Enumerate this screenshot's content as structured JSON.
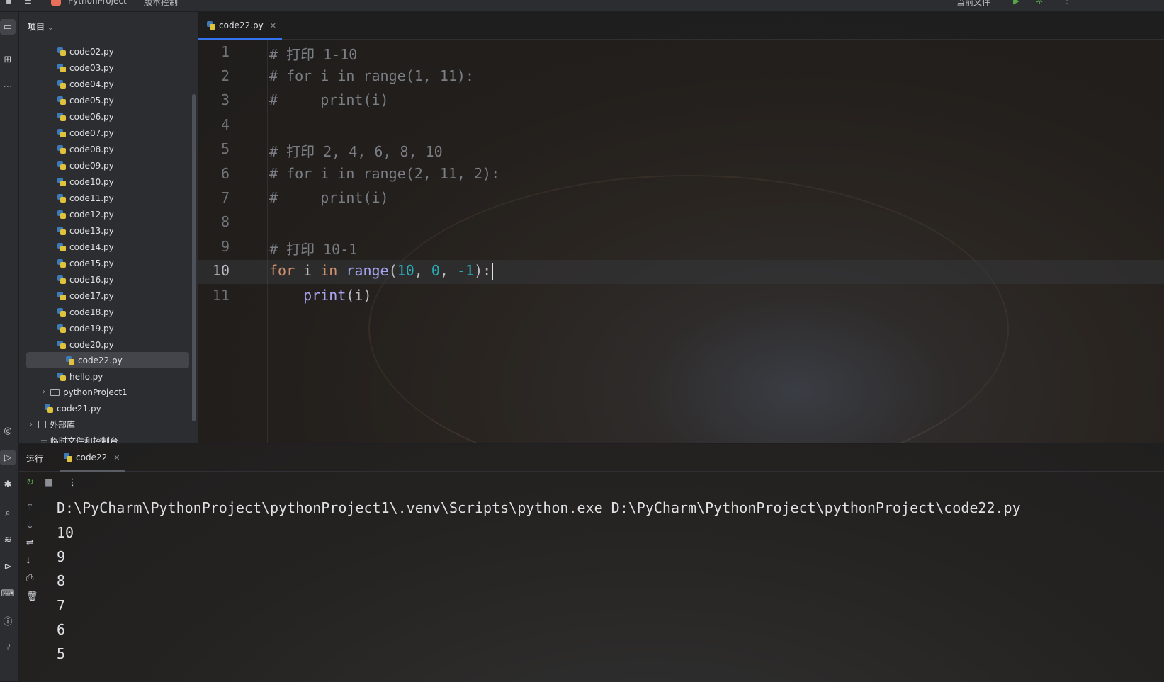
{
  "titlebar": {
    "project_name": "PythonProject",
    "vcs_label": "版本控制",
    "run_config": "当前文件"
  },
  "project_panel": {
    "header": "项目",
    "files": [
      {
        "name": "code02.py"
      },
      {
        "name": "code03.py"
      },
      {
        "name": "code04.py"
      },
      {
        "name": "code05.py"
      },
      {
        "name": "code06.py"
      },
      {
        "name": "code07.py"
      },
      {
        "name": "code08.py"
      },
      {
        "name": "code09.py"
      },
      {
        "name": "code10.py"
      },
      {
        "name": "code11.py"
      },
      {
        "name": "code12.py"
      },
      {
        "name": "code13.py"
      },
      {
        "name": "code14.py"
      },
      {
        "name": "code15.py"
      },
      {
        "name": "code16.py"
      },
      {
        "name": "code17.py"
      },
      {
        "name": "code18.py"
      },
      {
        "name": "code19.py"
      },
      {
        "name": "code20.py"
      },
      {
        "name": "code22.py",
        "selected": true
      },
      {
        "name": "hello.py"
      }
    ],
    "folder": "pythonProject1",
    "root_file": "code21.py",
    "external_libs": "外部库",
    "scratches": "临时文件和控制台"
  },
  "editor": {
    "tab": "code22.py",
    "current_line": "10",
    "lines": [
      {
        "n": "1",
        "text": "# 打印 1-10"
      },
      {
        "n": "2",
        "text": "# for i in range(1, 11):"
      },
      {
        "n": "3",
        "text": "#     print(i)"
      },
      {
        "n": "4",
        "text": ""
      },
      {
        "n": "5",
        "text": "# 打印 2, 4, 6, 8, 10"
      },
      {
        "n": "6",
        "text": "# for i in range(2, 11, 2):"
      },
      {
        "n": "7",
        "text": "#     print(i)"
      },
      {
        "n": "8",
        "text": ""
      },
      {
        "n": "9",
        "text": "# 打印 10-1"
      },
      {
        "n": "10",
        "code": {
          "kw1": "for",
          "var": " i ",
          "kw2": "in",
          "fn": "range",
          "open": "(",
          "a": "10",
          "sep1": ", ",
          "b": "0",
          "sep2": ", ",
          "c": "-1",
          "close": "):"
        }
      },
      {
        "n": "11",
        "code": {
          "indent": "    ",
          "fn": "print",
          "args": "(i)"
        }
      }
    ]
  },
  "run_panel": {
    "title": "运行",
    "tab": "code22",
    "command": "D:\\PyCharm\\PythonProject\\pythonProject1\\.venv\\Scripts\\python.exe D:\\PyCharm\\PythonProject\\pythonProject\\code22.py",
    "output": [
      "10",
      "9",
      "8",
      "7",
      "6",
      "5"
    ]
  },
  "icons": {
    "left_strip": [
      "folder-icon",
      "structure-icon",
      "more-icon",
      "python-console-icon",
      "run-icon",
      "debug-icon",
      "search-icon",
      "layers-icon",
      "services-icon",
      "terminal-icon",
      "problems-icon",
      "vcs-icon"
    ],
    "run_toolbar": [
      "rerun-icon",
      "stop-icon",
      "more-icon"
    ],
    "run_side": [
      "up-arrow-icon",
      "down-arrow-icon",
      "soft-wrap-icon",
      "scroll-to-end-icon",
      "print-icon",
      "trash-icon"
    ]
  },
  "colors": {
    "accent": "#3574f0",
    "keyword": "#cf8e6d",
    "function": "#a9a3f0",
    "number": "#2aacb8",
    "comment": "#7a7e85"
  }
}
